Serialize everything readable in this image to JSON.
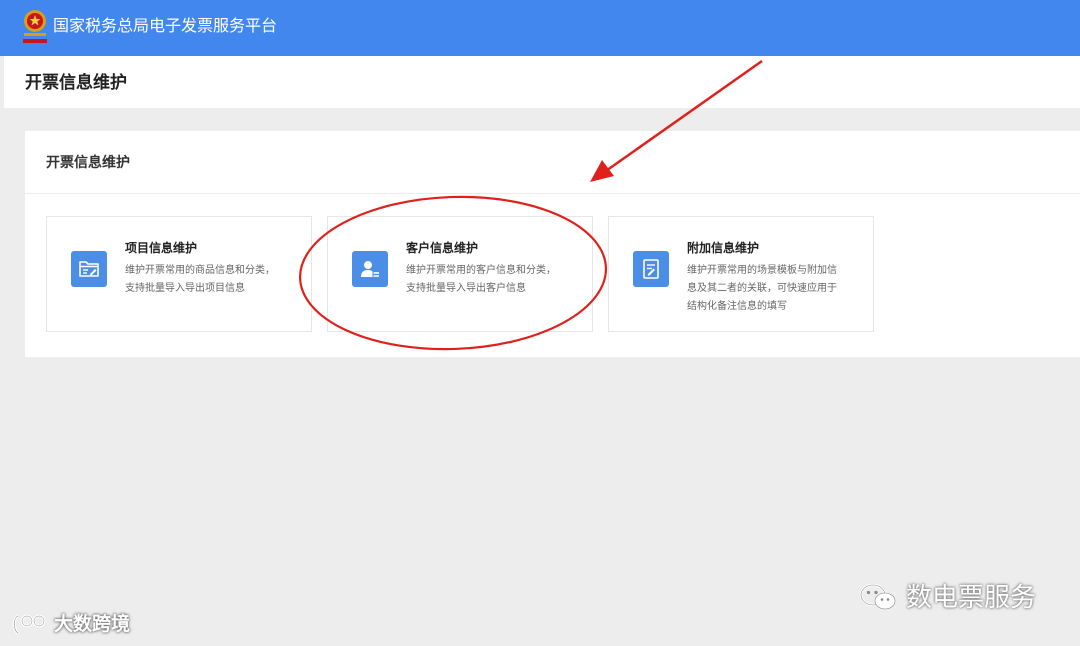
{
  "header": {
    "app_title": "国家税务总局电子发票服务平台",
    "background_color": "#4287ee",
    "emblem_icon": "national-emblem-icon"
  },
  "page": {
    "title": "开票信息维护"
  },
  "panel": {
    "title": "开票信息维护",
    "cards": [
      {
        "title": "项目信息维护",
        "desc_line1": "维护开票常用的商品信息和分类，",
        "desc_line2": "支持批量导入导出项目信息",
        "icon": "folder-edit-icon"
      },
      {
        "title": "客户信息维护",
        "desc_line1": "维护开票常用的客户信息和分类，",
        "desc_line2": "支持批量导入导出客户信息",
        "icon": "customer-card-icon"
      },
      {
        "title": "附加信息维护",
        "desc_line1": "维护开票常用的场景模板与附加信",
        "desc_line2": "息及其二者的关联，可快速应用于",
        "desc_line3": "结构化备注信息的填写",
        "icon": "document-edit-icon"
      }
    ],
    "icon_color": "#4a8ee8"
  },
  "annotation": {
    "color": "#e0201b"
  },
  "watermarks": {
    "right_text": "数电票服务",
    "left_text": "大数跨境"
  }
}
